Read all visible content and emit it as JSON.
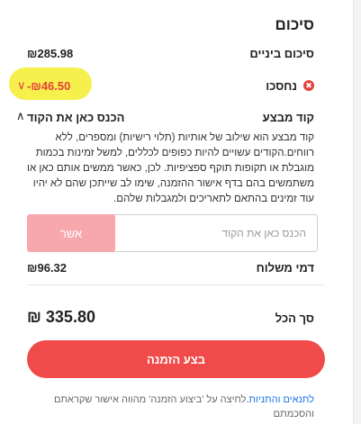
{
  "summary": {
    "title": "סיכום",
    "subtotal_label": "סיכום ביניים",
    "subtotal_value": "₪285.98",
    "savings_label": "נחסכו",
    "savings_value": "-₪46.50",
    "savings_icon": "✖",
    "coupon_label": "קוד מבצע",
    "coupon_toggle": "הכנס כאן את הקוד",
    "coupon_description": "קוד מבצע הוא שילוב של אותיות (תלוי רישיות) ומספרים, ללא רווחים.הקודים עשויים להיות כפופים לכללים, למשל זמינות בכמות מוגבלת או תקופות תוקף ספציפיות. לכן, כאשר ממשים אותם כאן או משתמשים בהם בדף אישור ההזמנה, שימו לב שייתכן שהם לא יהיו עוד זמינים בהתאם לתאריכים ולמגבלות שלהם.",
    "coupon_placeholder": "הכנס כאן את הקוד",
    "apply_label": "אשר",
    "shipping_label": "דמי משלוח",
    "shipping_value": "₪96.32",
    "total_label": "סך הכל",
    "total_value": "₪ 335.80",
    "order_button": "בצע הזמנה",
    "terms_link": "לתנאים והתניות",
    "terms_text": ".לחיצה על 'ביצוע הזמנה' מהווה אישור שקראתם והסכמתם"
  },
  "colors": {
    "accent": "#f04a4a",
    "savings": "#e5403a",
    "apply_disabled": "#f7a8ad",
    "highlight": "#f5ee3a",
    "link": "#1a73e8"
  }
}
